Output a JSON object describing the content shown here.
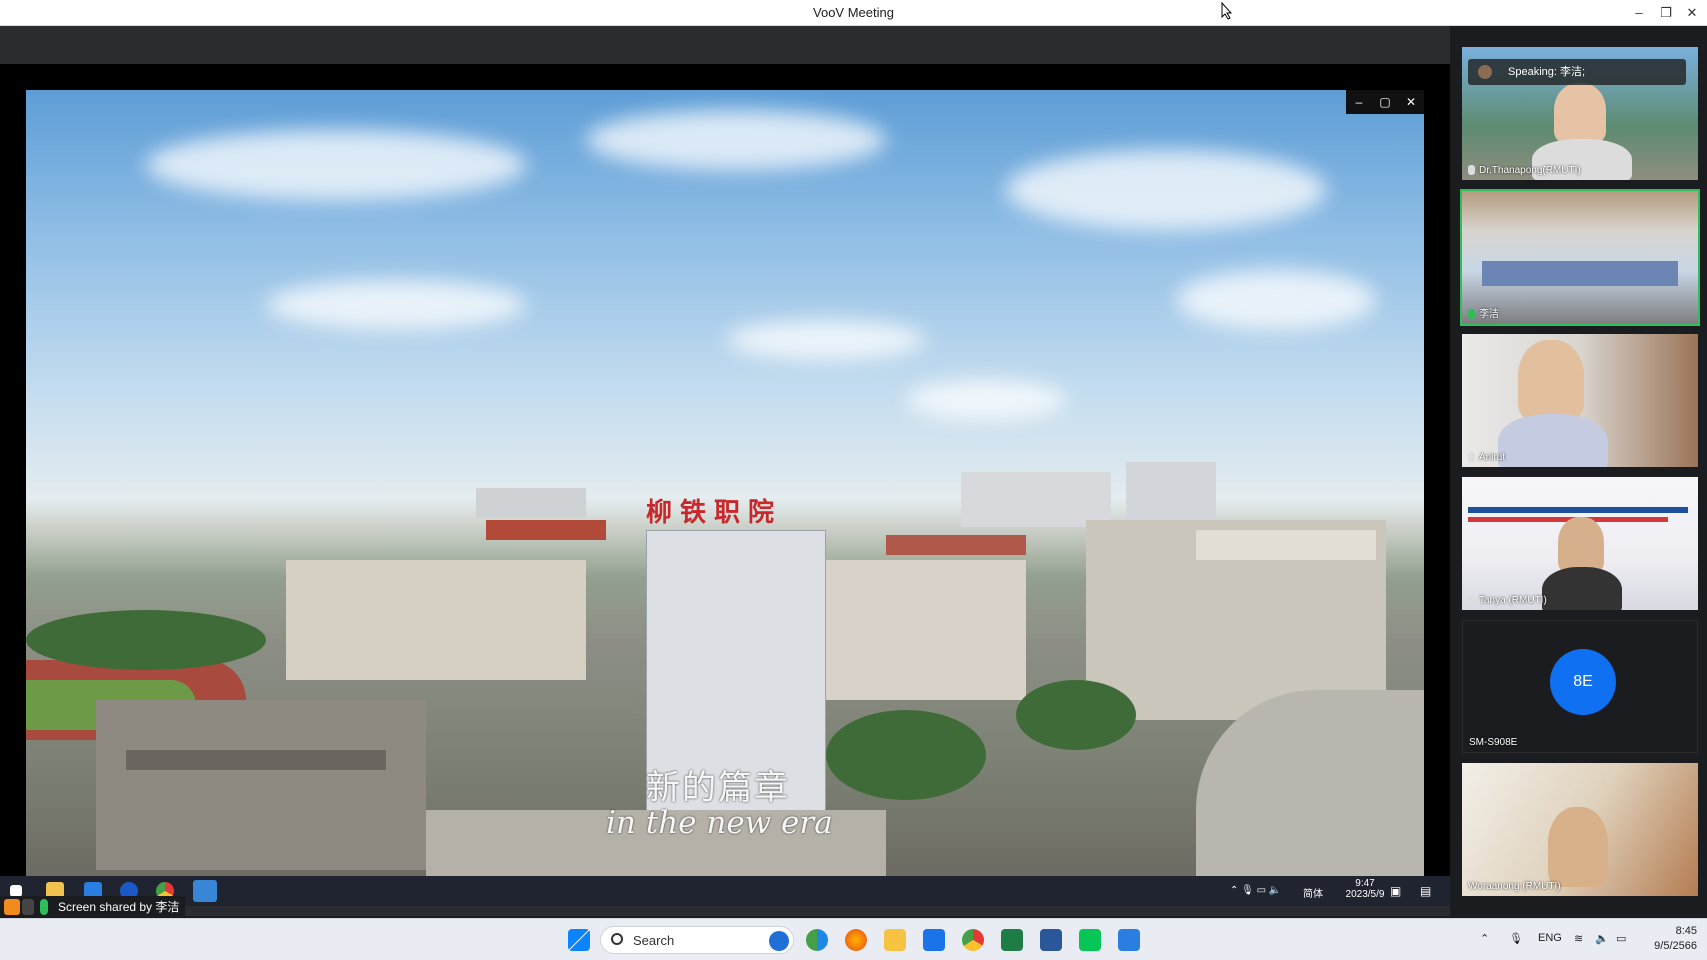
{
  "window": {
    "title": "VooV Meeting"
  },
  "shared_content": {
    "campus_name": "柳铁职院",
    "subtitle_cn": "新的篇章",
    "subtitle_en": "in the new era",
    "video_controls": [
      "–",
      "▢",
      "✕"
    ]
  },
  "remote_taskbar": {
    "lang": "简体",
    "time": "9:47",
    "date": "2023/5/9"
  },
  "share_badge": {
    "text": "Screen shared by 李洁"
  },
  "participants": [
    {
      "name": "Dr.Thanapong(RMUTI)",
      "speaking": "Speaking: 李洁;"
    },
    {
      "name": "李洁"
    },
    {
      "name": "Anirut"
    },
    {
      "name": "Tanya (RMUTI)"
    },
    {
      "name": "SM-S908E",
      "initials": "8E"
    },
    {
      "name": "Woraanong (RMUTI)"
    }
  ],
  "taskbar": {
    "search_placeholder": "Search",
    "lang": "ENG",
    "time": "8:45",
    "date": "9/5/2566"
  }
}
